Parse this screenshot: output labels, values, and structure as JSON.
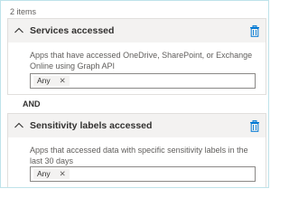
{
  "items_count": "2 items",
  "conditions": [
    {
      "title": "Services accessed",
      "description": "Apps that have accessed OneDrive, SharePoint, or Exchange Online using Graph API",
      "chip": "Any",
      "chip_remove": "✕",
      "collapse_icon": "chevron-up-icon",
      "delete_icon": "trash-icon"
    },
    {
      "title": "Sensitivity labels accessed",
      "description": "Apps that accessed data with specific sensitivity labels in the last 30 days",
      "chip": "Any",
      "chip_remove": "✕",
      "collapse_icon": "chevron-up-icon",
      "delete_icon": "trash-icon"
    }
  ],
  "operator": "AND",
  "colors": {
    "accent": "#0078d4",
    "header_bg": "#f3f2f1",
    "border": "#e1dfdd",
    "frame_border": "#bfe3ea"
  }
}
